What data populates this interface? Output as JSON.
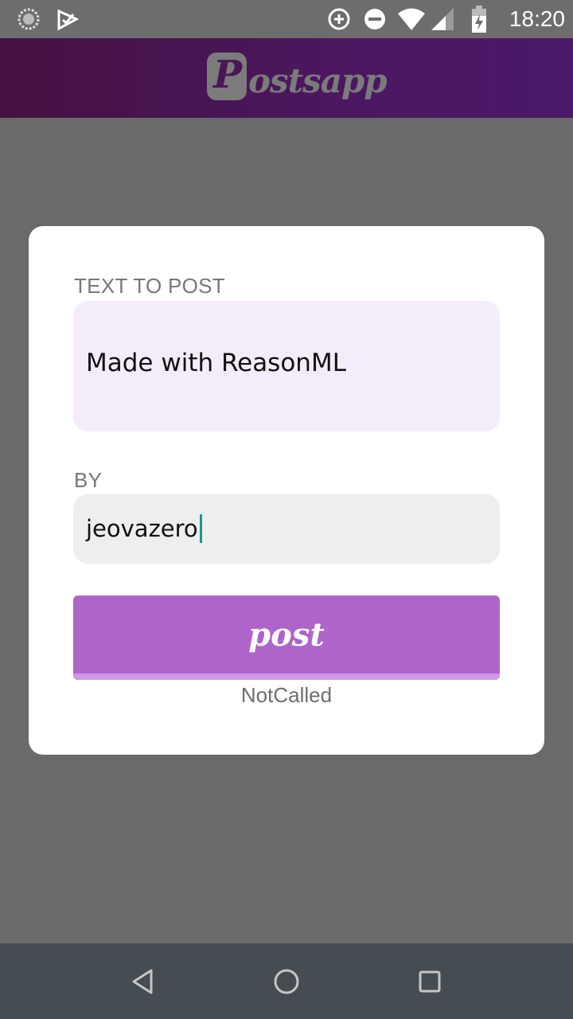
{
  "status_bar": {
    "time": "18:20",
    "icons": [
      "loading-spinner-icon",
      "checkmark-notification-icon",
      "data-saver-icon",
      "do-not-disturb-icon",
      "wifi-icon",
      "cellular-signal-icon",
      "battery-charging-icon"
    ]
  },
  "app_bar": {
    "logo_initial": "P",
    "logo_rest": "ostsapp"
  },
  "form": {
    "text_label": "TEXT TO POST",
    "text_value": "Made with ReasonML",
    "by_label": "BY",
    "by_value": "jeovazero",
    "post_button_label": "post",
    "status": "NotCalled"
  },
  "nav_bar": {
    "icons": [
      "back-icon",
      "home-icon",
      "recent-apps-icon"
    ]
  },
  "colors": {
    "app_bar": "#4a1656",
    "button": "#ae64c9",
    "text_field_bg": "#f4edf9",
    "by_field_bg": "#eeeeee",
    "caret": "#159a8e"
  }
}
